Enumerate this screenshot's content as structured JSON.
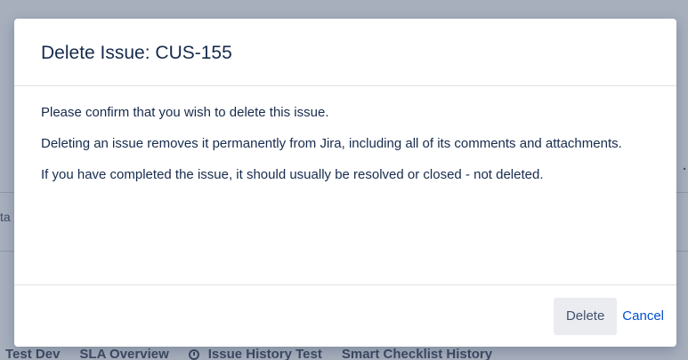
{
  "background": {
    "tabs": [
      {
        "label": "Test Dev"
      },
      {
        "label": "SLA Overview"
      },
      {
        "label": "Issue History Test",
        "icon": "history-icon"
      },
      {
        "label": "Smart Checklist History"
      }
    ],
    "fragment_text": "ta",
    "dot": "."
  },
  "dialog": {
    "title": "Delete Issue: CUS-155",
    "paragraphs": [
      "Please confirm that you wish to delete this issue.",
      "Deleting an issue removes it permanently from Jira, including all of its comments and attachments.",
      "If you have completed the issue, it should usually be resolved or closed - not deleted."
    ],
    "delete_label": "Delete",
    "cancel_label": "Cancel"
  },
  "colors": {
    "overlay": "#a7afbd",
    "title_text": "#172b4d",
    "link": "#0052cc",
    "button_bg": "#ebecf0"
  }
}
